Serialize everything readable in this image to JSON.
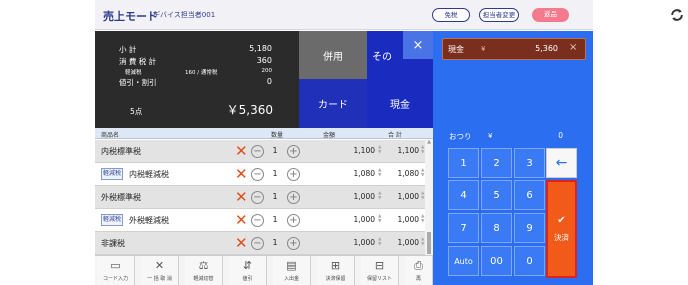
{
  "header": {
    "mode_title": "売上モード",
    "device_name": "デバイス担当者001",
    "tax_free_button": "免税",
    "change_staff_button": "担当者変更",
    "return_button": "返品",
    "refresh_icon": "refresh-icon"
  },
  "summary": {
    "subtotal_label": "小 計",
    "subtotal_value": "5,180",
    "consumption_tax_label": "消 費 税 計",
    "consumption_tax_value": "360",
    "reduced_tax_label": "軽減税",
    "reduced_tax_detail": "160 / 通常税",
    "reduced_tax_value": "200",
    "discount_label": "値引・割引",
    "discount_value": "0",
    "items_count": "5点",
    "total": "￥5,360"
  },
  "payment_buttons": {
    "combo": "併用",
    "other": "その",
    "card": "カード",
    "cash": "現金",
    "close_icon": "×"
  },
  "list": {
    "headers": {
      "name": "商品名",
      "quantity": "数量",
      "amount": "金額",
      "subtotal": "合 計"
    },
    "items": [
      {
        "badge": "",
        "name": "内税標準税",
        "qty": "1",
        "amount": "1,100",
        "subtotal": "1,100"
      },
      {
        "badge": "軽減税",
        "name": "内税軽減税",
        "qty": "1",
        "amount": "1,080",
        "subtotal": "1,080"
      },
      {
        "badge": "",
        "name": "外税標準税",
        "qty": "1",
        "amount": "1,000",
        "subtotal": "1,000"
      },
      {
        "badge": "軽減税",
        "name": "外税軽減税",
        "qty": "1",
        "amount": "1,000",
        "subtotal": "1,000"
      },
      {
        "badge": "",
        "name": "非課税",
        "qty": "1",
        "amount": "1,000",
        "subtotal": "1,000"
      }
    ]
  },
  "toolbar": {
    "items": [
      {
        "icon": "barcode-icon",
        "glyph": "▭",
        "label": "コード入力"
      },
      {
        "icon": "clear-icon",
        "glyph": "✕",
        "label": "一 括 取 消"
      },
      {
        "icon": "tax-switch-icon",
        "glyph": "⚖",
        "label": "軽減切替"
      },
      {
        "icon": "discount-icon",
        "glyph": "⇵",
        "label": "値引"
      },
      {
        "icon": "cash-drawer-icon",
        "glyph": "▤",
        "label": "入出金"
      },
      {
        "icon": "basket-icon",
        "glyph": "⊞",
        "label": "決済保留"
      },
      {
        "icon": "hold-list-icon",
        "glyph": "⊟",
        "label": "保留リスト"
      },
      {
        "icon": "reprint-icon",
        "glyph": "⎙",
        "label": "再"
      }
    ]
  },
  "payment_panel": {
    "cash_label": "現金",
    "cash_yen": "¥",
    "cash_amount": "5,360",
    "cash_close": "×",
    "change_label": "おつり",
    "change_yen": "¥",
    "change_amount": "0",
    "keys": [
      "1",
      "2",
      "3",
      "4",
      "5",
      "6",
      "7",
      "8",
      "9",
      "Auto",
      "00",
      "0"
    ],
    "backspace": "←",
    "settle_icon": "✔",
    "settle_label": "決済"
  }
}
